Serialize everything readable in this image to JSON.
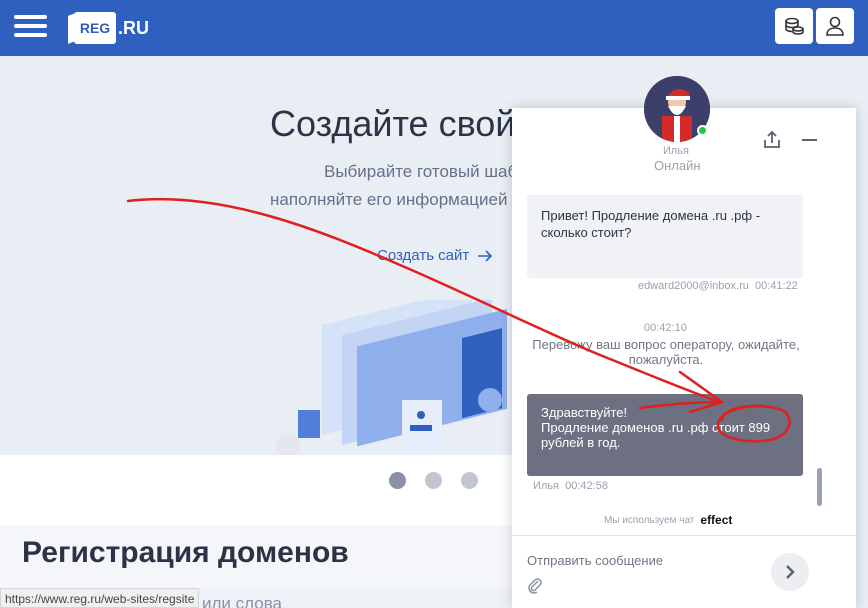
{
  "header": {
    "logo_text": "REG",
    "logo_suffix": ".RU"
  },
  "hero": {
    "title": "Создайте свой",
    "subtitle_line1": "Выбирайте готовый шаб",
    "subtitle_line2": "наполняйте его информацией и",
    "cta": "Создать сайт"
  },
  "carousel": {
    "pages": 3
  },
  "domains": {
    "title": "Регистрация доменов",
    "subtitle_fragment": "или слова"
  },
  "status_bar": {
    "url": "https://www.reg.ru/web-sites/regsite"
  },
  "chat": {
    "agent_name": "Илья",
    "agent_status": "Онлайн",
    "messages": [
      {
        "text": "Привет! Продление домена .ru .рф - сколько стоит?",
        "author": "edward2000@inbox.ru",
        "time": "00:41:22"
      },
      {
        "system_time": "00:42:10",
        "system_text": "Перевожу ваш вопрос оператору, ожидайте, пожалуйста."
      },
      {
        "line1": "Здравствуйте!",
        "line2": "Продление доменов .ru .рф стоит 899 рублей в год.",
        "author": "Илья",
        "time": "00:42:58"
      }
    ],
    "powered_by": "Мы используем чат",
    "powered_brand": "effect",
    "input_placeholder": "Отправить сообщение"
  },
  "colors": {
    "brand_blue": "#2f5fbf",
    "operator_bubble": "#6c7081",
    "annotation_red": "#e0201c",
    "online": "#27c24c"
  }
}
